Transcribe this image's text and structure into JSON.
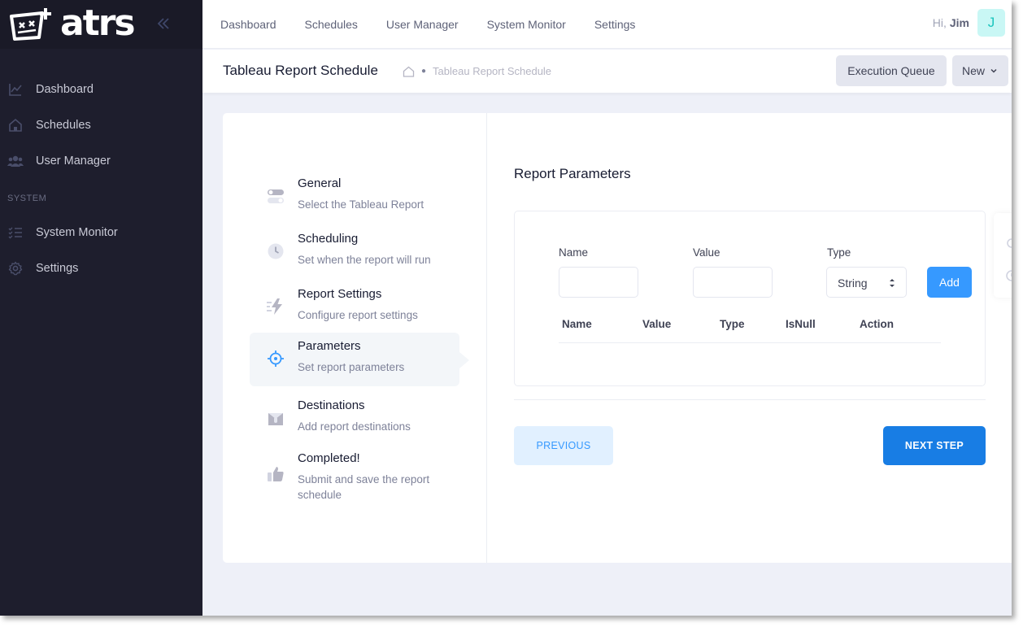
{
  "app": {
    "logo_text": "atrs"
  },
  "sidebar": {
    "items": [
      {
        "label": "Dashboard",
        "icon": "chart-line-icon"
      },
      {
        "label": "Schedules",
        "icon": "home-icon"
      },
      {
        "label": "User Manager",
        "icon": "users-icon"
      }
    ],
    "section_label": "SYSTEM",
    "system_items": [
      {
        "label": "System Monitor",
        "icon": "list-icon"
      },
      {
        "label": "Settings",
        "icon": "gear-icon"
      }
    ]
  },
  "topnav": {
    "links": [
      "Dashboard",
      "Schedules",
      "User Manager",
      "System Monitor",
      "Settings"
    ]
  },
  "user": {
    "greeting": "Hi,",
    "name": "Jim",
    "initial": "J"
  },
  "subheader": {
    "title": "Tableau Report Schedule",
    "breadcrumb": "Tableau Report Schedule",
    "queue_button": "Execution Queue",
    "new_button": "New"
  },
  "wizard": {
    "steps": [
      {
        "title": "General",
        "desc": "Select the Tableau Report",
        "icon": "toggle-icon"
      },
      {
        "title": "Scheduling",
        "desc": "Set when the report will run",
        "icon": "clock-icon"
      },
      {
        "title": "Report Settings",
        "desc": "Configure report settings",
        "icon": "lightning-icon"
      },
      {
        "title": "Parameters",
        "desc": "Set report parameters",
        "icon": "target-icon",
        "active": true
      },
      {
        "title": "Destinations",
        "desc": "Add report destinations",
        "icon": "mailbox-icon"
      },
      {
        "title": "Completed!",
        "desc": "Submit and save the report schedule",
        "icon": "thumbs-up-icon"
      }
    ]
  },
  "params": {
    "section_title": "Report Parameters",
    "name_label": "Name",
    "value_label": "Value",
    "type_label": "Type",
    "name_value": "",
    "value_value": "",
    "type_selected": "String",
    "add_button": "Add",
    "table_headers": [
      "Name",
      "Value",
      "Type",
      "IsNull",
      "Action"
    ]
  },
  "actions": {
    "previous": "PREVIOUS",
    "next": "NEXT STEP"
  },
  "colors": {
    "primary": "#3699ff",
    "next": "#187de4",
    "sidebar_bg": "#1e1e2d",
    "avatar_bg": "#c9f7f5"
  }
}
